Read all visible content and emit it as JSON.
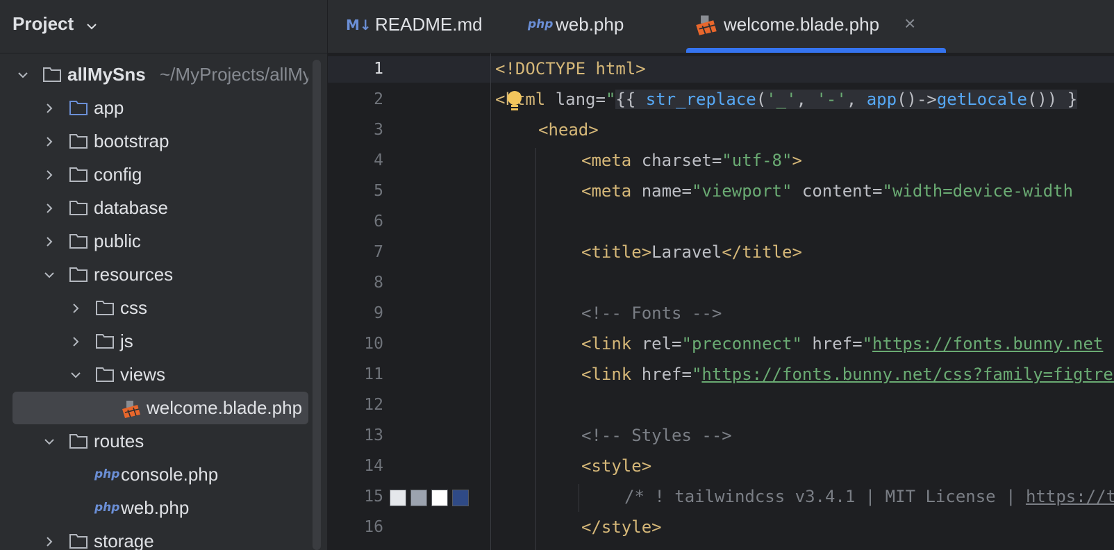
{
  "sidebar": {
    "title": "Project",
    "tree": [
      {
        "label": "allMySns",
        "path": "~/MyProjects/allMySns"
      },
      {
        "label": "app"
      },
      {
        "label": "bootstrap"
      },
      {
        "label": "config"
      },
      {
        "label": "database"
      },
      {
        "label": "public"
      },
      {
        "label": "resources"
      },
      {
        "label": "css"
      },
      {
        "label": "js"
      },
      {
        "label": "views"
      },
      {
        "label": "welcome.blade.php"
      },
      {
        "label": "routes"
      },
      {
        "label": "console.php"
      },
      {
        "label": "web.php"
      },
      {
        "label": "storage"
      }
    ],
    "php_icon_text": "php"
  },
  "tabs": [
    {
      "label": "README.md",
      "icon_text": "M↓"
    },
    {
      "label": "web.php",
      "icon_text": "php"
    },
    {
      "label": "welcome.blade.php",
      "close_glyph": "×"
    }
  ],
  "editor": {
    "line_numbers": [
      "1",
      "2",
      "3",
      "4",
      "5",
      "6",
      "7",
      "8",
      "9",
      "10",
      "11",
      "12",
      "13",
      "14",
      "15",
      "16"
    ],
    "lines": {
      "l1": {
        "doctype": "<!DOCTYPE html>"
      },
      "l2": {
        "lt": "<",
        "tag": "html",
        "attr": " lang=",
        "q": "\"",
        "open": "{{ ",
        "fn1": "str_replace",
        "args1": "(",
        "s1": "'_'",
        "c1": ", ",
        "s2": "'-'",
        "c2": ", ",
        "fn2": "app",
        "args2": "()->",
        "fn3": "getLocale",
        "args3": "()) }"
      },
      "l3": {
        "tag": "<head>"
      },
      "l4": {
        "tag_open": "<meta",
        "attr": " charset=",
        "val": "\"utf-8\"",
        "close": ">"
      },
      "l5": {
        "tag_open": "<meta",
        "attr1": " name=",
        "val1": "\"viewport\"",
        "attr2": " content=",
        "val2": "\"width=device-width"
      },
      "l7": {
        "t1": "<title>",
        "text": "Laravel",
        "t2": "</title>"
      },
      "l9": {
        "comment": "<!-- Fonts -->"
      },
      "l10": {
        "tag_open": "<link",
        "attr1": " rel=",
        "val1": "\"preconnect\"",
        "attr2": " href=",
        "q": "\"",
        "url": "https://fonts.bunny.net"
      },
      "l11": {
        "tag_open": "<link",
        "attr": " href=",
        "q": "\"",
        "url": "https://fonts.bunny.net/css?family=figtree"
      },
      "l13": {
        "comment": "<!-- Styles -->"
      },
      "l14": {
        "tag": "<style>"
      },
      "l15": {
        "comment": "/* ! tailwindcss v3.4.1 | MIT License | ",
        "link": "https://tailwindcss.com"
      },
      "l16": {
        "tag": "</style>"
      }
    },
    "color_swatches": [
      "#e5e7eb",
      "#9ca3af",
      "#ffffff",
      "#2f4a86"
    ]
  },
  "colors": {
    "accent": "#3574f0",
    "tag": "#d5b778",
    "string": "#6aab73",
    "function": "#56a8f5",
    "comment": "#7a7e85",
    "folder_blue": "#6b8fd6",
    "blade_orange": "#e8672c",
    "bulb": "#f2c55c"
  }
}
